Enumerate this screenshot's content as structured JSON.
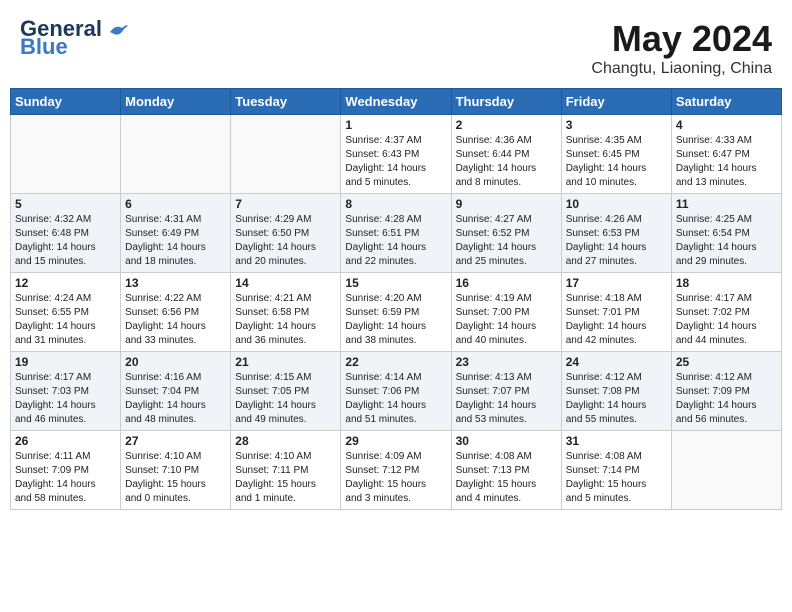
{
  "header": {
    "logo_text_general": "General",
    "logo_text_blue": "Blue",
    "month_year": "May 2024",
    "location": "Changtu, Liaoning, China"
  },
  "days_of_week": [
    "Sunday",
    "Monday",
    "Tuesday",
    "Wednesday",
    "Thursday",
    "Friday",
    "Saturday"
  ],
  "weeks": [
    [
      {
        "day": "",
        "info": ""
      },
      {
        "day": "",
        "info": ""
      },
      {
        "day": "",
        "info": ""
      },
      {
        "day": "1",
        "info": "Sunrise: 4:37 AM\nSunset: 6:43 PM\nDaylight: 14 hours\nand 5 minutes."
      },
      {
        "day": "2",
        "info": "Sunrise: 4:36 AM\nSunset: 6:44 PM\nDaylight: 14 hours\nand 8 minutes."
      },
      {
        "day": "3",
        "info": "Sunrise: 4:35 AM\nSunset: 6:45 PM\nDaylight: 14 hours\nand 10 minutes."
      },
      {
        "day": "4",
        "info": "Sunrise: 4:33 AM\nSunset: 6:47 PM\nDaylight: 14 hours\nand 13 minutes."
      }
    ],
    [
      {
        "day": "5",
        "info": "Sunrise: 4:32 AM\nSunset: 6:48 PM\nDaylight: 14 hours\nand 15 minutes."
      },
      {
        "day": "6",
        "info": "Sunrise: 4:31 AM\nSunset: 6:49 PM\nDaylight: 14 hours\nand 18 minutes."
      },
      {
        "day": "7",
        "info": "Sunrise: 4:29 AM\nSunset: 6:50 PM\nDaylight: 14 hours\nand 20 minutes."
      },
      {
        "day": "8",
        "info": "Sunrise: 4:28 AM\nSunset: 6:51 PM\nDaylight: 14 hours\nand 22 minutes."
      },
      {
        "day": "9",
        "info": "Sunrise: 4:27 AM\nSunset: 6:52 PM\nDaylight: 14 hours\nand 25 minutes."
      },
      {
        "day": "10",
        "info": "Sunrise: 4:26 AM\nSunset: 6:53 PM\nDaylight: 14 hours\nand 27 minutes."
      },
      {
        "day": "11",
        "info": "Sunrise: 4:25 AM\nSunset: 6:54 PM\nDaylight: 14 hours\nand 29 minutes."
      }
    ],
    [
      {
        "day": "12",
        "info": "Sunrise: 4:24 AM\nSunset: 6:55 PM\nDaylight: 14 hours\nand 31 minutes."
      },
      {
        "day": "13",
        "info": "Sunrise: 4:22 AM\nSunset: 6:56 PM\nDaylight: 14 hours\nand 33 minutes."
      },
      {
        "day": "14",
        "info": "Sunrise: 4:21 AM\nSunset: 6:58 PM\nDaylight: 14 hours\nand 36 minutes."
      },
      {
        "day": "15",
        "info": "Sunrise: 4:20 AM\nSunset: 6:59 PM\nDaylight: 14 hours\nand 38 minutes."
      },
      {
        "day": "16",
        "info": "Sunrise: 4:19 AM\nSunset: 7:00 PM\nDaylight: 14 hours\nand 40 minutes."
      },
      {
        "day": "17",
        "info": "Sunrise: 4:18 AM\nSunset: 7:01 PM\nDaylight: 14 hours\nand 42 minutes."
      },
      {
        "day": "18",
        "info": "Sunrise: 4:17 AM\nSunset: 7:02 PM\nDaylight: 14 hours\nand 44 minutes."
      }
    ],
    [
      {
        "day": "19",
        "info": "Sunrise: 4:17 AM\nSunset: 7:03 PM\nDaylight: 14 hours\nand 46 minutes."
      },
      {
        "day": "20",
        "info": "Sunrise: 4:16 AM\nSunset: 7:04 PM\nDaylight: 14 hours\nand 48 minutes."
      },
      {
        "day": "21",
        "info": "Sunrise: 4:15 AM\nSunset: 7:05 PM\nDaylight: 14 hours\nand 49 minutes."
      },
      {
        "day": "22",
        "info": "Sunrise: 4:14 AM\nSunset: 7:06 PM\nDaylight: 14 hours\nand 51 minutes."
      },
      {
        "day": "23",
        "info": "Sunrise: 4:13 AM\nSunset: 7:07 PM\nDaylight: 14 hours\nand 53 minutes."
      },
      {
        "day": "24",
        "info": "Sunrise: 4:12 AM\nSunset: 7:08 PM\nDaylight: 14 hours\nand 55 minutes."
      },
      {
        "day": "25",
        "info": "Sunrise: 4:12 AM\nSunset: 7:09 PM\nDaylight: 14 hours\nand 56 minutes."
      }
    ],
    [
      {
        "day": "26",
        "info": "Sunrise: 4:11 AM\nSunset: 7:09 PM\nDaylight: 14 hours\nand 58 minutes."
      },
      {
        "day": "27",
        "info": "Sunrise: 4:10 AM\nSunset: 7:10 PM\nDaylight: 15 hours\nand 0 minutes."
      },
      {
        "day": "28",
        "info": "Sunrise: 4:10 AM\nSunset: 7:11 PM\nDaylight: 15 hours\nand 1 minute."
      },
      {
        "day": "29",
        "info": "Sunrise: 4:09 AM\nSunset: 7:12 PM\nDaylight: 15 hours\nand 3 minutes."
      },
      {
        "day": "30",
        "info": "Sunrise: 4:08 AM\nSunset: 7:13 PM\nDaylight: 15 hours\nand 4 minutes."
      },
      {
        "day": "31",
        "info": "Sunrise: 4:08 AM\nSunset: 7:14 PM\nDaylight: 15 hours\nand 5 minutes."
      },
      {
        "day": "",
        "info": ""
      }
    ]
  ]
}
